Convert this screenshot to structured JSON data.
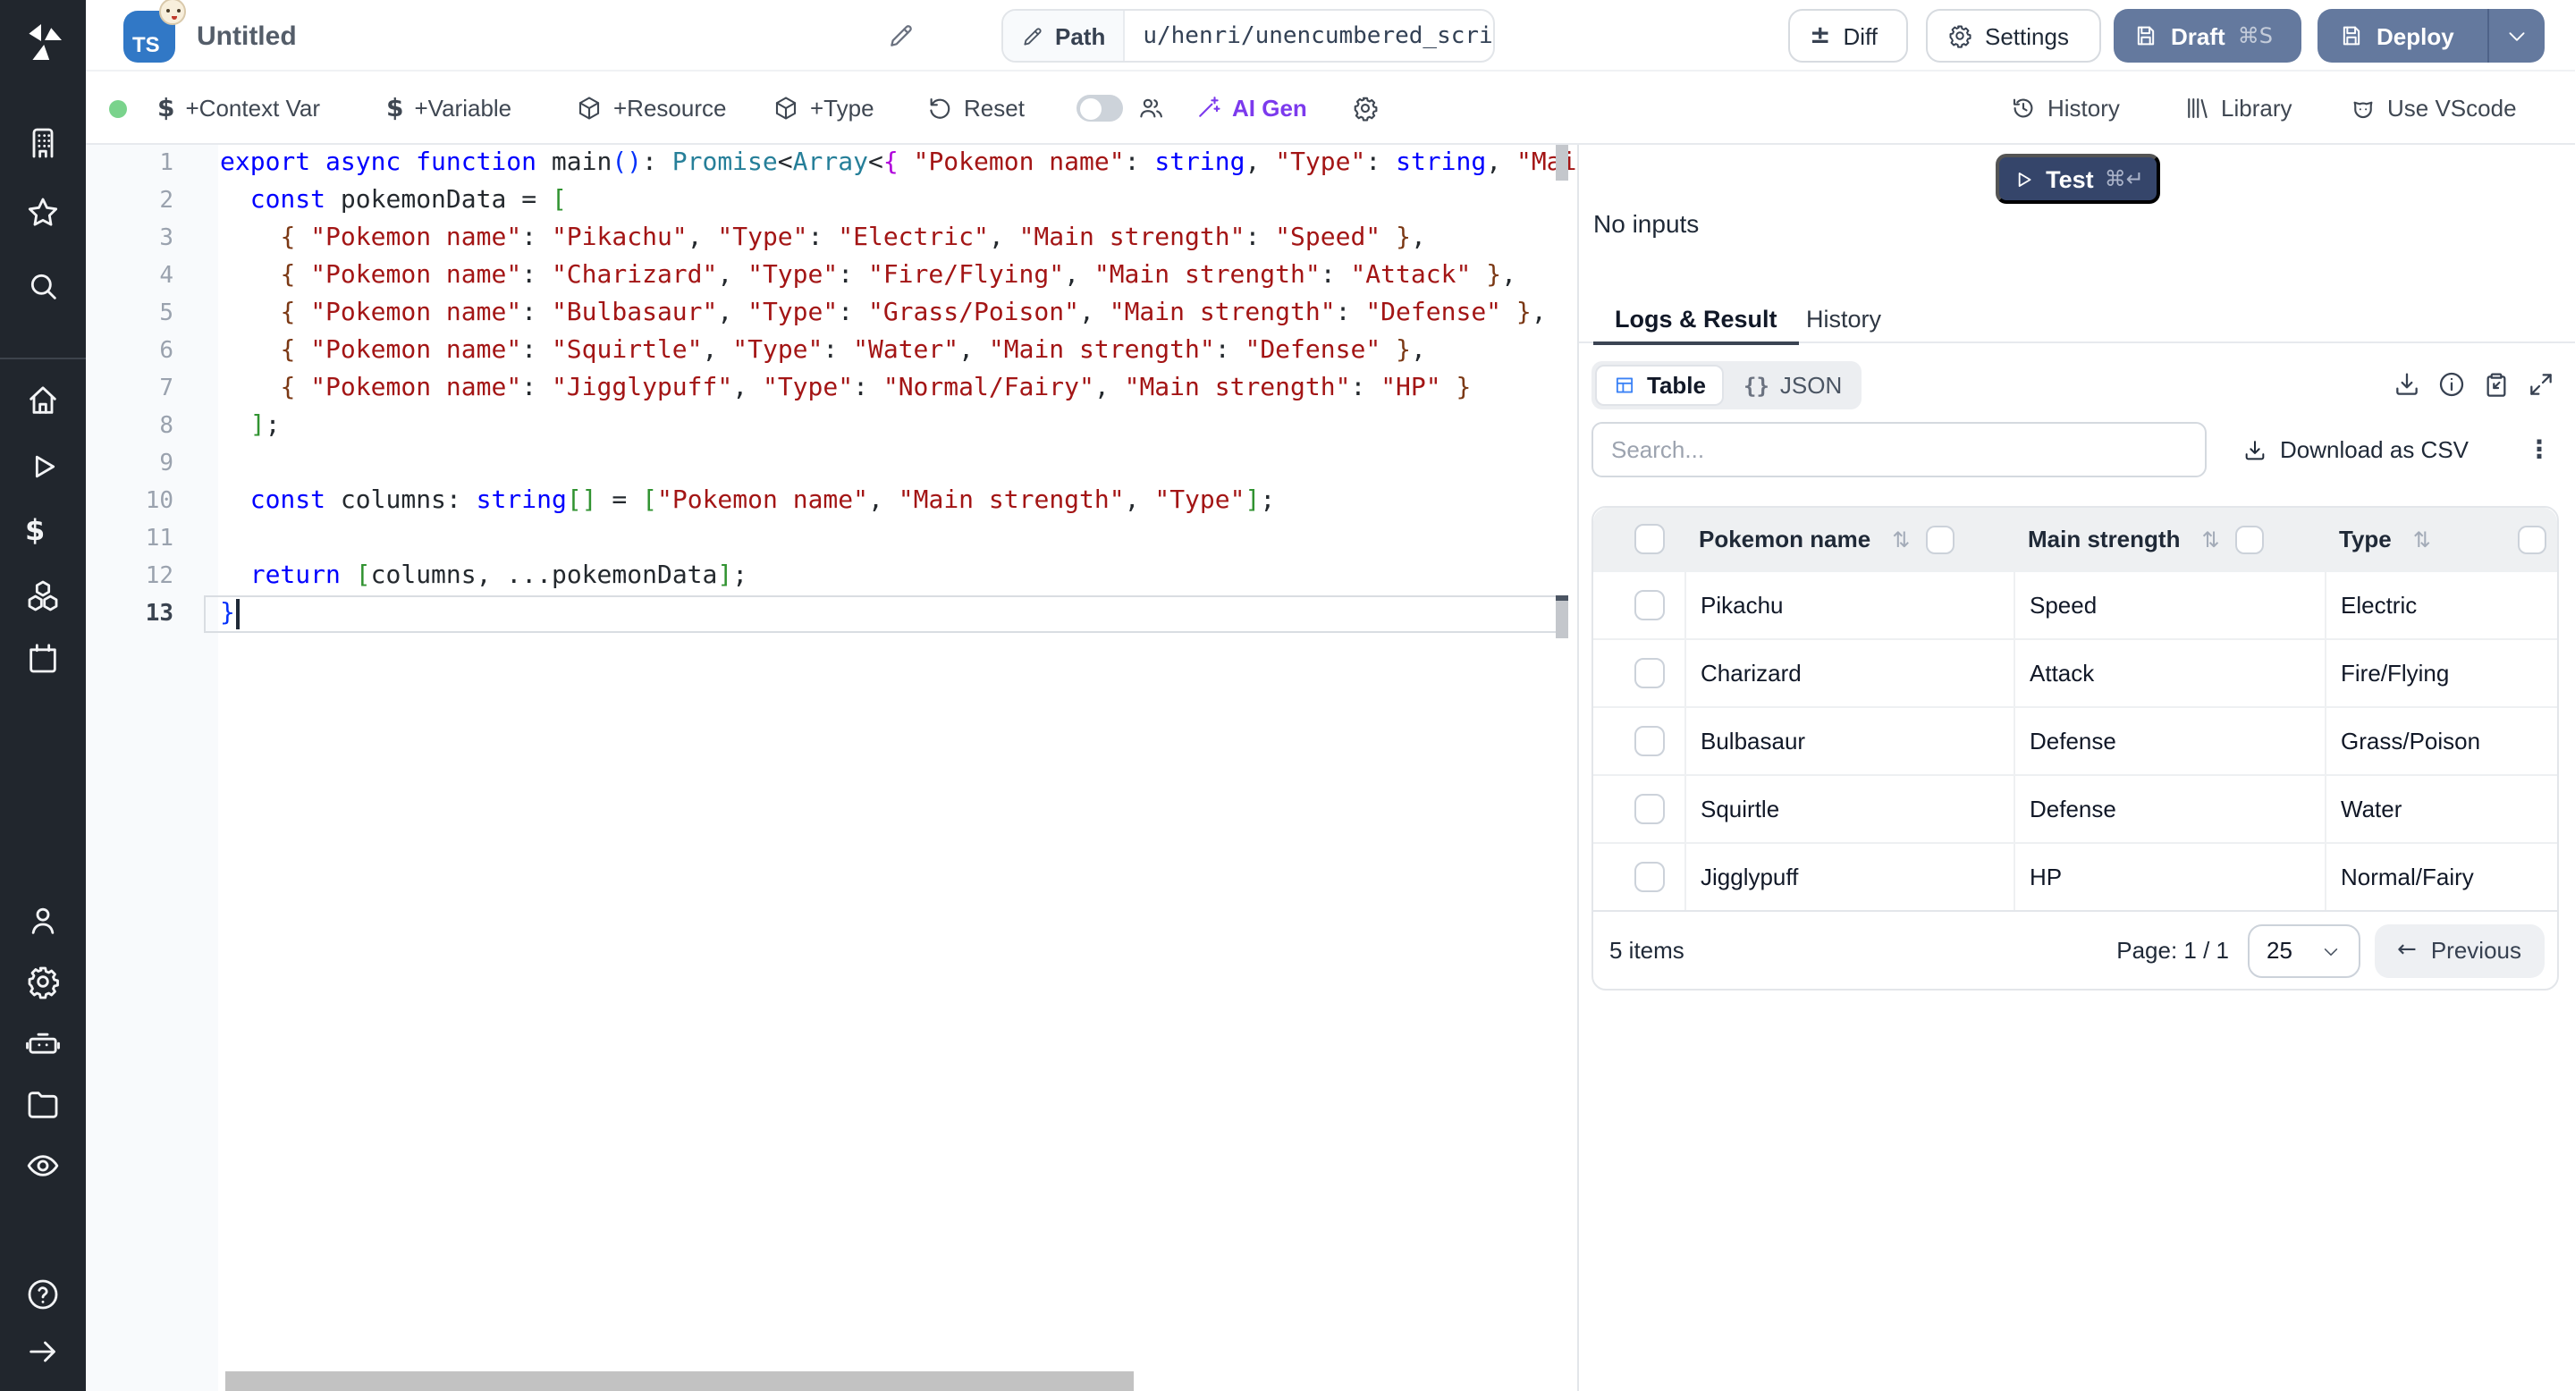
{
  "topbar": {
    "language_badge": "TS",
    "title": "Untitled",
    "path_label": "Path",
    "path_value": "u/henri/unencumbered_script",
    "diff_label": "Diff",
    "settings_label": "Settings",
    "draft_label": "Draft",
    "draft_shortcut": "⌘S",
    "deploy_label": "Deploy"
  },
  "toolbar": {
    "status_color": "#7ad38c",
    "add_context_var": "+Context Var",
    "add_variable": "+Variable",
    "add_resource": "+Resource",
    "add_type": "+Type",
    "reset": "Reset",
    "ai_gen": "AI Gen",
    "ai_gen_color": "#7c3aed",
    "history": "History",
    "library": "Library",
    "use_vscode": "Use VScode"
  },
  "sidebar": {
    "icons": [
      "building",
      "star",
      "search",
      "home",
      "play",
      "dollar",
      "cubes",
      "calendar",
      "person",
      "gear",
      "robot",
      "folder",
      "eye",
      "help",
      "arrow-right"
    ]
  },
  "editor": {
    "token_colors": {
      "k": "#0000ff",
      "f": "#24292e",
      "t": "#267f99",
      "s": "#a31515",
      "p": "#24292e",
      "v": "#24292e",
      "b1": "#0431fa",
      "b2": "#319331",
      "b3": "#7b3814",
      "bp": "#af00db"
    },
    "active_line": 13,
    "lines": [
      [
        [
          "k",
          "export async function "
        ],
        [
          "f",
          "main"
        ],
        [
          "b1",
          "()"
        ],
        [
          "p",
          ": "
        ],
        [
          "t",
          "Promise"
        ],
        [
          "p",
          "<"
        ],
        [
          "t",
          "Array"
        ],
        [
          "p",
          "<"
        ],
        [
          "bp",
          "{"
        ],
        [
          "p",
          " "
        ],
        [
          "s",
          "\"Pokemon name\""
        ],
        [
          "p",
          ": "
        ],
        [
          "k",
          "string"
        ],
        [
          "p",
          ", "
        ],
        [
          "s",
          "\"Type\""
        ],
        [
          "p",
          ": "
        ],
        [
          "k",
          "string"
        ],
        [
          "p",
          ", "
        ],
        [
          "s",
          "\"Mai"
        ]
      ],
      [
        [
          "p",
          "  "
        ],
        [
          "k",
          "const"
        ],
        [
          "p",
          " "
        ],
        [
          "v",
          "pokemonData"
        ],
        [
          "p",
          " = "
        ],
        [
          "b2",
          "["
        ]
      ],
      [
        [
          "p",
          "    "
        ],
        [
          "b3",
          "{"
        ],
        [
          "p",
          " "
        ],
        [
          "s",
          "\"Pokemon name\""
        ],
        [
          "p",
          ": "
        ],
        [
          "s",
          "\"Pikachu\""
        ],
        [
          "p",
          ", "
        ],
        [
          "s",
          "\"Type\""
        ],
        [
          "p",
          ": "
        ],
        [
          "s",
          "\"Electric\""
        ],
        [
          "p",
          ", "
        ],
        [
          "s",
          "\"Main strength\""
        ],
        [
          "p",
          ": "
        ],
        [
          "s",
          "\"Speed\""
        ],
        [
          "p",
          " "
        ],
        [
          "b3",
          "}"
        ],
        [
          "p",
          ","
        ]
      ],
      [
        [
          "p",
          "    "
        ],
        [
          "b3",
          "{"
        ],
        [
          "p",
          " "
        ],
        [
          "s",
          "\"Pokemon name\""
        ],
        [
          "p",
          ": "
        ],
        [
          "s",
          "\"Charizard\""
        ],
        [
          "p",
          ", "
        ],
        [
          "s",
          "\"Type\""
        ],
        [
          "p",
          ": "
        ],
        [
          "s",
          "\"Fire/Flying\""
        ],
        [
          "p",
          ", "
        ],
        [
          "s",
          "\"Main strength\""
        ],
        [
          "p",
          ": "
        ],
        [
          "s",
          "\"Attack\""
        ],
        [
          "p",
          " "
        ],
        [
          "b3",
          "}"
        ],
        [
          "p",
          ","
        ]
      ],
      [
        [
          "p",
          "    "
        ],
        [
          "b3",
          "{"
        ],
        [
          "p",
          " "
        ],
        [
          "s",
          "\"Pokemon name\""
        ],
        [
          "p",
          ": "
        ],
        [
          "s",
          "\"Bulbasaur\""
        ],
        [
          "p",
          ", "
        ],
        [
          "s",
          "\"Type\""
        ],
        [
          "p",
          ": "
        ],
        [
          "s",
          "\"Grass/Poison\""
        ],
        [
          "p",
          ", "
        ],
        [
          "s",
          "\"Main strength\""
        ],
        [
          "p",
          ": "
        ],
        [
          "s",
          "\"Defense\""
        ],
        [
          "p",
          " "
        ],
        [
          "b3",
          "}"
        ],
        [
          "p",
          ","
        ]
      ],
      [
        [
          "p",
          "    "
        ],
        [
          "b3",
          "{"
        ],
        [
          "p",
          " "
        ],
        [
          "s",
          "\"Pokemon name\""
        ],
        [
          "p",
          ": "
        ],
        [
          "s",
          "\"Squirtle\""
        ],
        [
          "p",
          ", "
        ],
        [
          "s",
          "\"Type\""
        ],
        [
          "p",
          ": "
        ],
        [
          "s",
          "\"Water\""
        ],
        [
          "p",
          ", "
        ],
        [
          "s",
          "\"Main strength\""
        ],
        [
          "p",
          ": "
        ],
        [
          "s",
          "\"Defense\""
        ],
        [
          "p",
          " "
        ],
        [
          "b3",
          "}"
        ],
        [
          "p",
          ","
        ]
      ],
      [
        [
          "p",
          "    "
        ],
        [
          "b3",
          "{"
        ],
        [
          "p",
          " "
        ],
        [
          "s",
          "\"Pokemon name\""
        ],
        [
          "p",
          ": "
        ],
        [
          "s",
          "\"Jigglypuff\""
        ],
        [
          "p",
          ", "
        ],
        [
          "s",
          "\"Type\""
        ],
        [
          "p",
          ": "
        ],
        [
          "s",
          "\"Normal/Fairy\""
        ],
        [
          "p",
          ", "
        ],
        [
          "s",
          "\"Main strength\""
        ],
        [
          "p",
          ": "
        ],
        [
          "s",
          "\"HP\""
        ],
        [
          "p",
          " "
        ],
        [
          "b3",
          "}"
        ]
      ],
      [
        [
          "p",
          "  "
        ],
        [
          "b2",
          "]"
        ],
        [
          "p",
          ";"
        ]
      ],
      [],
      [
        [
          "p",
          "  "
        ],
        [
          "k",
          "const"
        ],
        [
          "p",
          " "
        ],
        [
          "v",
          "columns"
        ],
        [
          "p",
          ": "
        ],
        [
          "k",
          "string"
        ],
        [
          "b2",
          "[]"
        ],
        [
          "p",
          " = "
        ],
        [
          "b2",
          "["
        ],
        [
          "s",
          "\"Pokemon name\""
        ],
        [
          "p",
          ", "
        ],
        [
          "s",
          "\"Main strength\""
        ],
        [
          "p",
          ", "
        ],
        [
          "s",
          "\"Type\""
        ],
        [
          "b2",
          "]"
        ],
        [
          "p",
          ";"
        ]
      ],
      [],
      [
        [
          "p",
          "  "
        ],
        [
          "k",
          "return"
        ],
        [
          "p",
          " "
        ],
        [
          "b2",
          "["
        ],
        [
          "v",
          "columns"
        ],
        [
          "p",
          ", ..."
        ],
        [
          "v",
          "pokemonData"
        ],
        [
          "b2",
          "]"
        ],
        [
          "p",
          ";"
        ]
      ],
      [
        [
          "b1",
          "}"
        ]
      ]
    ]
  },
  "run_panel": {
    "test_label": "Test",
    "test_shortcut": "⌘↵",
    "no_inputs": "No inputs",
    "tabs": [
      "Logs & Result",
      "History"
    ],
    "active_tab": "Logs & Result",
    "views": [
      "Table",
      "JSON"
    ],
    "active_view": "Table",
    "search_placeholder": "Search...",
    "download_csv": "Download as CSV",
    "table": {
      "columns": [
        "Pokemon name",
        "Main strength",
        "Type"
      ],
      "rows": [
        [
          "Pikachu",
          "Speed",
          "Electric"
        ],
        [
          "Charizard",
          "Attack",
          "Fire/Flying"
        ],
        [
          "Bulbasaur",
          "Defense",
          "Grass/Poison"
        ],
        [
          "Squirtle",
          "Defense",
          "Water"
        ],
        [
          "Jigglypuff",
          "HP",
          "Normal/Fairy"
        ]
      ],
      "items_label": "5 items",
      "page_label": "Page: 1 / 1",
      "page_size": "25",
      "previous_label": "Previous"
    }
  }
}
